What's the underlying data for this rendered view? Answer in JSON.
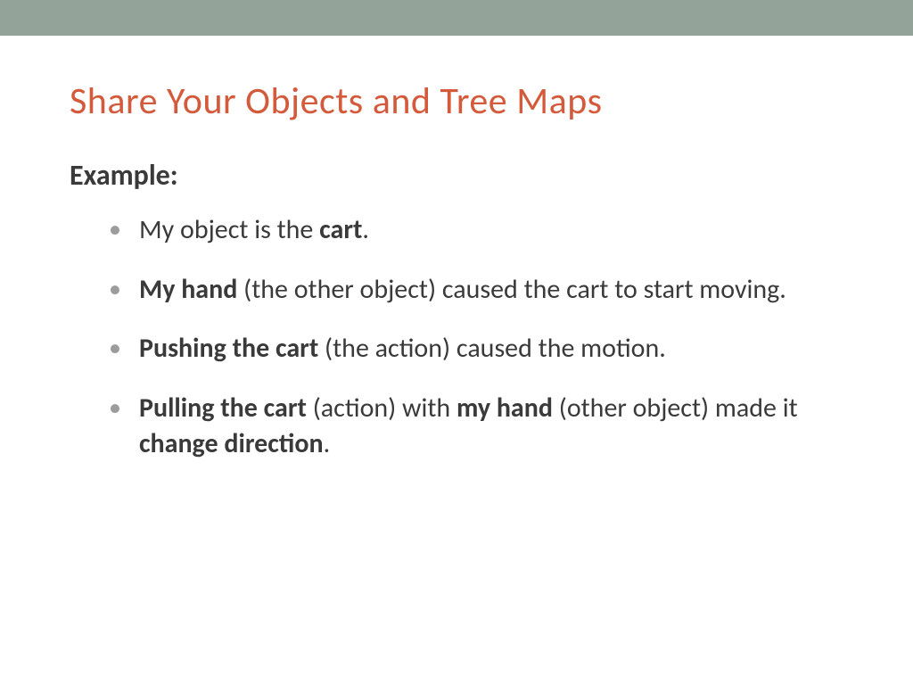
{
  "title": "Share Your Objects and Tree Maps",
  "example_label": "Example:",
  "bullets": [
    {
      "pre": "My object is the ",
      "b1": "cart",
      "post": "."
    },
    {
      "b1": "My hand",
      "mid1": " (the other object) caused the cart to start moving."
    },
    {
      "b1": "Pushing the cart",
      "mid1": " (the action) caused the motion."
    },
    {
      "b1": "Pulling the cart",
      "mid1": " (action) with ",
      "b2": "my hand",
      "mid2": " (other object) made it ",
      "b3": "change direction",
      "post": "."
    }
  ]
}
